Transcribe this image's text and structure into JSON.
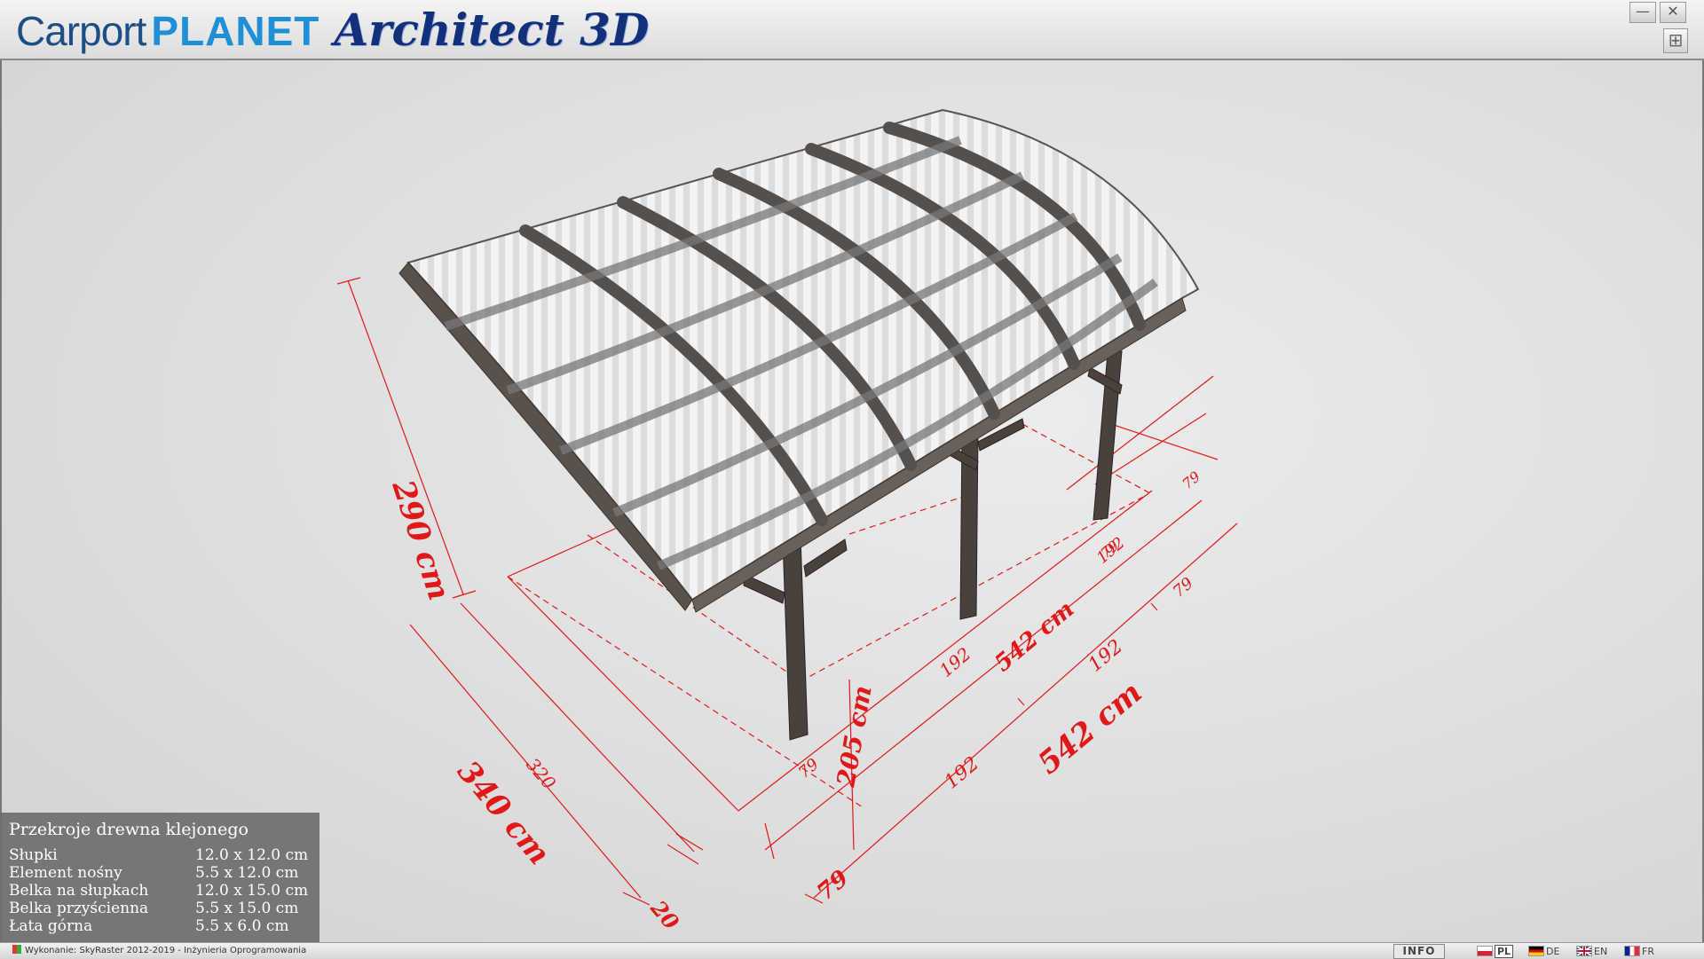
{
  "app": {
    "brand_left": "Carport",
    "brand_right": "PLANET",
    "product": "Architect 3D",
    "minimize_glyph": "—",
    "close_glyph": "✕",
    "maximize_glyph": "⊞"
  },
  "dimensions": {
    "height_total": "290 cm",
    "width_total": "340 cm",
    "width_inner": "320",
    "width_offset": "20",
    "length_total": "542 cm",
    "length_inner": "542 cm",
    "post_height": "205 cm",
    "bay_1": "192",
    "bay_2": "192",
    "bay_top": "192",
    "bay_top_2": "192",
    "overhang_front": "79",
    "overhang_back": "79",
    "overhang_small_1": "79",
    "overhang_small_2": "79",
    "overhang_small_3": "79"
  },
  "info": {
    "title": "Przekroje drewna klejonego",
    "rows": [
      {
        "label": "Słupki",
        "value": "12.0 x 12.0 cm"
      },
      {
        "label": "Element nośny",
        "value": "5.5 x 12.0 cm"
      },
      {
        "label": "Belka na słupkach",
        "value": "12.0 x 15.0 cm"
      },
      {
        "label": "Belka przyścienna",
        "value": "5.5 x 15.0 cm"
      },
      {
        "label": "Łata górna",
        "value": "5.5 x 6.0 cm"
      }
    ]
  },
  "status": {
    "credits": "Wykonanie: SkyRaster  2012-2019 - Inżynieria Oprogramowania",
    "info_button": "INFO",
    "languages": [
      {
        "code": "PL",
        "active": true
      },
      {
        "code": "DE",
        "active": false
      },
      {
        "code": "EN",
        "active": false
      },
      {
        "code": "FR",
        "active": false
      }
    ]
  },
  "colors": {
    "dimension": "#e01818",
    "wood": "#4a403c",
    "roof_panel": "#f2f2f2",
    "brand_dark": "#1c4f86",
    "brand_light": "#1f8fd6"
  }
}
